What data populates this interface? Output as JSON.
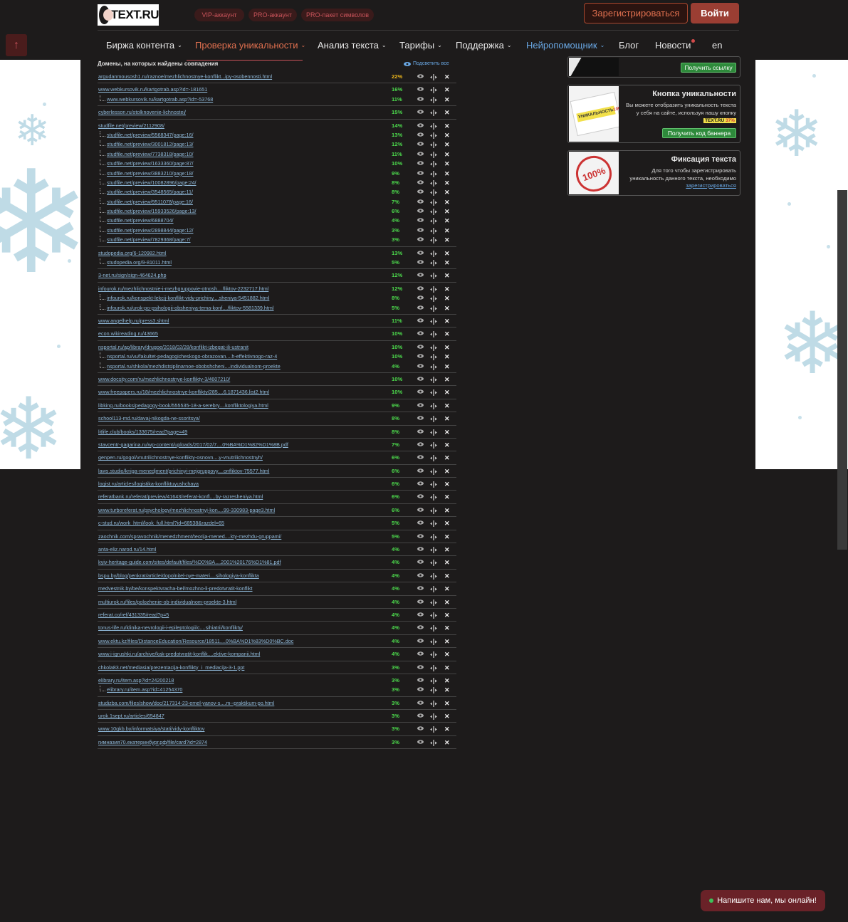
{
  "header": {
    "logo_text": "TEXT.RU",
    "pills": [
      "VIP-аккаунт",
      "PRO-аккаунт",
      "PRO-пакет символов"
    ],
    "register_label": "Зарегистрироваться",
    "login_label": "Войти"
  },
  "nav": {
    "items": [
      {
        "label": "Биржа контента",
        "chevron": "⌄"
      },
      {
        "label": "Проверка уникальности",
        "chevron": "⌄"
      },
      {
        "label": "Анализ текста",
        "chevron": "⌄"
      },
      {
        "label": "Тарифы",
        "chevron": "⌄"
      },
      {
        "label": "Поддержка",
        "chevron": "⌄"
      },
      {
        "label": "Нейропомощник",
        "chevron": "⌄"
      },
      {
        "label": "Блог",
        "chevron": ""
      },
      {
        "label": "Новости",
        "chevron": ""
      },
      {
        "label": "en",
        "chevron": ""
      }
    ]
  },
  "scroll_top_icon": "↑",
  "results": {
    "title": "Домены, на которых найдены совпадения",
    "highlight_all": "Подсветить все",
    "groups": [
      [
        [
          "argudanmousosh1.ru/raznoe/mezhlichnostnye-konflikt...ipy-osobennosti.html",
          "22%"
        ]
      ],
      [
        [
          "www.webkursovik.ru/kartgotrab.asp?id=-181651",
          "16%"
        ],
        [
          "www.webkursovik.ru/kartgotrab.asp?id=-53768",
          "11%"
        ]
      ],
      [
        [
          "cyberlesson.ru/stolknovenie-lichnostej/",
          "15%"
        ]
      ],
      [
        [
          "studfile.net/preview/2112908/",
          "14%"
        ],
        [
          "studfile.net/preview/5568347/page:16/",
          "13%"
        ],
        [
          "studfile.net/preview/3001812/page:13/",
          "12%"
        ],
        [
          "studfile.net/preview/7738318/page:10/",
          "11%"
        ],
        [
          "studfile.net/preview/1633360/page:87/",
          "10%"
        ],
        [
          "studfile.net/preview/3883210/page:18/",
          "9%"
        ],
        [
          "studfile.net/preview/10082896/page:24/",
          "8%"
        ],
        [
          "studfile.net/preview/3548565/page:11/",
          "8%"
        ],
        [
          "studfile.net/preview/9511078/page:16/",
          "7%"
        ],
        [
          "studfile.net/preview/15933526/page:13/",
          "6%"
        ],
        [
          "studfile.net/preview/6888704/",
          "4%"
        ],
        [
          "studfile.net/preview/2898844/page:12/",
          "3%"
        ],
        [
          "studfile.net/preview/7829368/page:7/",
          "3%"
        ]
      ],
      [
        [
          "studopedia.org/6-120982.html",
          "13%"
        ],
        [
          "studopedia.org/9-81011.html",
          "5%"
        ]
      ],
      [
        [
          "3-net.ru/sign/sign-464624.php",
          "12%"
        ]
      ],
      [
        [
          "infourok.ru/mezhlichnostnie-i-mezhgruppovie-otnosh....fliktov-2232717.html",
          "12%"
        ],
        [
          "infourok.ru/konspekt-lekcij-konflikt-vidy-prichiny....sheniya-5451882.html",
          "8%"
        ],
        [
          "infourok.ru/urok-po-psihologii-obsheniya-tema-konf....fliktov-5581339.html",
          "5%"
        ]
      ],
      [
        [
          "www.angelhelp.ru/press3.shtml",
          "11%"
        ]
      ],
      [
        [
          "econ.wikireading.ru/43665",
          "10%"
        ]
      ],
      [
        [
          "nsportal.ru/ap/library/drugoe/2018/02/28/konflikt-izbegat-ili-ustranit",
          "10%"
        ],
        [
          "nsportal.ru/vu/fakultet-pedagogicheskogo-obrazovan....h-effektivnogo-raz-4",
          "10%"
        ],
        [
          "nsportal.ru/shkola/mezhdistsiplinarnoe-obobshcheni....individualnom-proekte",
          "4%"
        ]
      ],
      [
        [
          "www.docsity.com/ru/mezhlichnostnye-konflikty-3/4607210/",
          "10%"
        ]
      ],
      [
        [
          "www.freepapers.ru/18/mezhlichnostnye-konflikty/285....6.1871436.list2.html",
          "10%"
        ]
      ],
      [
        [
          "libking.ru/books/pedagogy-book/555535-18-a-serebry....konfliktologiya.html",
          "9%"
        ]
      ],
      [
        [
          "school113-md.ru/davaj-nikogda-ne-ssoritsya/",
          "8%"
        ]
      ],
      [
        [
          "litlife.club/books/133675/read?page=49",
          "8%"
        ]
      ],
      [
        [
          "stavcentr-gagarina.ru/wp-content/uploads/2017/02/7....0%BA%D1%82%D1%8B.pdf",
          "7%"
        ]
      ],
      [
        [
          "genpen.ru/gogol/vnutrilichnostnye-konflikty-osnovn....y-vnutrilichnostnyh/",
          "6%"
        ]
      ],
      [
        [
          "laws.studio/kniga-menedjment/prichinyi-mejgruppovy....onfliktov-75577.html",
          "6%"
        ]
      ],
      [
        [
          "logist.ru/articles/logistika-konfliktuyushchaya",
          "6%"
        ]
      ],
      [
        [
          "referatbank.ru/referat/preview/41643/referat-konfl....by-razresheniya.html",
          "6%"
        ]
      ],
      [
        [
          "www.turboreferat.ru/psychology/mezhlichnostnyj-kon....99-330983-page3.html",
          "6%"
        ]
      ],
      [
        [
          "c-stud.ru/work_html/look_full.html?id=68538&razdel=65",
          "5%"
        ]
      ],
      [
        [
          "zaochnik.com/spravochnik/menedzhment/teorija-mened....kty-mezhdu-gruppami/",
          "5%"
        ]
      ],
      [
        [
          "anta-eliz.narod.ru/14.html",
          "4%"
        ]
      ],
      [
        [
          "kyiv-heritage-guide.com/sites/default/files/%D0%9A....2001%20176%D1%81.pdf",
          "4%"
        ]
      ],
      [
        [
          "bspu.by/blog/penkrat/article/dopolnitel-nye-materi....sihologiya-konflikta",
          "4%"
        ]
      ],
      [
        [
          "medvestnik.by/be/konspektvracha-bel/mozhno-li-predotvratit-konflikt",
          "4%"
        ]
      ],
      [
        [
          "multiurok.ru/files/polozhenie-ob-individualnom-proekte-3.html",
          "4%"
        ]
      ],
      [
        [
          "referat.co/ref/431335/read?p=5",
          "4%"
        ]
      ],
      [
        [
          "tonus-life.ru/klinika-nevrologii-i-epileptologii/c....sihiatrii/konflikty/",
          "4%"
        ]
      ],
      [
        [
          "www.ektu.kz/files/DistanceEducation/Resource/18511....0%BA%D1%83%D0%BC.doc",
          "4%"
        ]
      ],
      [
        [
          "www.i-igrushki.ru/archive/kak-predotvratit-konflik....ektive-kompanii.html",
          "4%"
        ]
      ],
      [
        [
          "chkola83.net/mediasia/prezentacija-konflikty_i_mediacija-3-1.ppt",
          "3%"
        ]
      ],
      [
        [
          "elibrary.ru/item.asp?id=24200218",
          "3%"
        ],
        [
          "elibrary.ru/item.asp?id=41254370",
          "3%"
        ]
      ],
      [
        [
          "studizba.com/files/show/doc/217314-23-emel-yanov-s....m--praktikum-po.html",
          "3%"
        ]
      ],
      [
        [
          "urok.1sept.ru/articles/654847",
          "3%"
        ]
      ],
      [
        [
          "www.10gkb.by/informatsiya/stati/vidy-konfliktov",
          "3%"
        ]
      ],
      [
        [
          "гимназия70.екатеринбург.рф/file/card?id=2874",
          "3%"
        ]
      ]
    ]
  },
  "icons": {
    "view": "eye-icon",
    "compare": "compare-icon",
    "delete": "close-icon"
  },
  "widgets": {
    "link": {
      "button": "Получить ссылку"
    },
    "banner": {
      "title": "Кнопка уникальности",
      "text": "Вы можете отобразить уникальность текста у себя на сайте, используя нашу кнопку",
      "badge_name": "TEXT.RU",
      "badge_value": "37%",
      "button": "Получить код баннера",
      "image_text": "УНИКАЛЬНОСТЬ",
      "image_value": "100%"
    },
    "fix": {
      "title": "Фиксация текста",
      "text": "Для того чтобы зарегистрировать уникальность данного текста, необходимо",
      "link": "зарегистрироваться",
      "image_value": "100%"
    }
  },
  "chat": {
    "label": "Напишите нам, мы онлайн!"
  },
  "colors": {
    "accent": "#c8535a",
    "percent_green": "#4ddc4d",
    "percent_top": "#e8b31c",
    "link": "#8fb8d8",
    "background": "#1d1b1b"
  }
}
